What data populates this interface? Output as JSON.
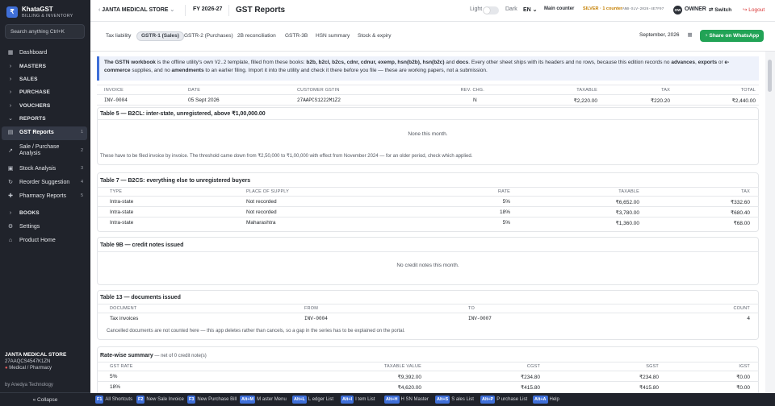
{
  "sidebar": {
    "brand_name": "KhataGST",
    "brand_sub": "BILLING & INVENTORY",
    "brand_logo": "₹",
    "search_placeholder": "Search anything  Ctrl+K",
    "items": [
      {
        "label": "Dashboard",
        "icon": "dashboard-icon",
        "glyph": "▦",
        "count": ""
      },
      {
        "label": "MASTERS",
        "icon": "chevron-right-icon",
        "glyph": "›",
        "count": ""
      },
      {
        "label": "SALES",
        "icon": "chevron-right-icon",
        "glyph": "›",
        "count": ""
      },
      {
        "label": "PURCHASE",
        "icon": "chevron-right-icon",
        "glyph": "›",
        "count": ""
      },
      {
        "label": "VOUCHERS",
        "icon": "chevron-right-icon",
        "glyph": "›",
        "count": ""
      },
      {
        "label": "REPORTS",
        "icon": "chevron-down-icon",
        "glyph": "⌄",
        "count": ""
      },
      {
        "label": "GST Reports",
        "icon": "report-icon",
        "glyph": "▤",
        "count": "1"
      },
      {
        "label": "Sale / Purchase Analysis",
        "icon": "analysis-icon",
        "glyph": "↗",
        "count": "2"
      },
      {
        "label": "Stock Analysis",
        "icon": "stock-icon",
        "glyph": "▣",
        "count": "3"
      },
      {
        "label": "Reorder Suggestion",
        "icon": "reorder-icon",
        "glyph": "↻",
        "count": "4"
      },
      {
        "label": "Pharmacy Reports",
        "icon": "pharmacy-icon",
        "glyph": "✚",
        "count": "5"
      },
      {
        "label": "BOOKS",
        "icon": "chevron-right-icon",
        "glyph": "›",
        "count": ""
      },
      {
        "label": "Settings",
        "icon": "gear-icon",
        "glyph": "⚙",
        "count": ""
      },
      {
        "label": "Product Home",
        "icon": "home-icon",
        "glyph": "⌂",
        "count": ""
      }
    ],
    "shop_name": "JANTA MEDICAL STORE",
    "shop_gstin": "27AAQCS4547K1ZN",
    "shop_type": "Medical / Pharmacy",
    "byline": "by Anedya Technology",
    "collapse_label": "« Collapse"
  },
  "topbar": {
    "store": "JANTA MEDICAL STORE",
    "fy": "FY 2026-27",
    "page_title": "GST Reports",
    "light_label": "Light",
    "dark_label": "Dark",
    "lang": "EN",
    "counter": "Main counter",
    "license": "SILVER · 1 counter",
    "license_key": "ANB-SLV-2026-4E7F97",
    "owner_initials": "OW",
    "owner": "OWNER",
    "switch_label": "Switch",
    "logout_label": "Logout"
  },
  "tabs": [
    "Tax liability",
    "GSTR-1 (Sales)",
    "GSTR-2 (Purchases)",
    "2B reconciliation",
    "GSTR-3B",
    "HSN summary",
    "Stock & expiry"
  ],
  "tab_active": "GSTR-1 (Sales)",
  "period": {
    "month": "September, 2026"
  },
  "whatsapp_label": "Share on WhatsApp",
  "banner": {
    "lead": "The GSTN workbook",
    "text1": " is the offline utility's own ",
    "version": "V2.2",
    "text2": " template, filled from these books: ",
    "books": "b2b, b2cl, b2cs, cdnr, cdnur, exemp, hsn(b2b), hsn(b2c)",
    "text3": " and ",
    "books_last": "docs",
    "text4": ". Every other sheet ships with its headers and no rows, because this edition records no ",
    "adv": "advances",
    "text5": ", ",
    "exp": "exports",
    "text6": " or ",
    "ecom": "e-commerce",
    "text7": " supplies, and no ",
    "amend": "amendments",
    "text8": " to an earlier filing. Import it into the utility and check it there before you file — these are working papers, not a submission."
  },
  "b2b": {
    "headers": [
      "INVOICE",
      "DATE",
      "CUSTOMER GSTIN",
      "REV. CHG.",
      "TAXABLE",
      "TAX",
      "TOTAL"
    ],
    "rows": [
      [
        "INV-0004",
        "05 Sept 2026",
        "27AAPCS1222M1Z2",
        "N",
        "₹2,220.00",
        "₹220.20",
        "₹2,440.00"
      ]
    ]
  },
  "b2cl": {
    "title": "Table 5 — B2CL: inter-state, unregistered, above ₹1,00,000.00",
    "empty": "None this month.",
    "note": "These have to be filed invoice by invoice. The threshold came down from ₹2,50,000 to ₹1,00,000 with effect from November 2024 — for an older period, check which applied."
  },
  "b2cs": {
    "title": "Table 7 — B2CS: everything else to unregistered buyers",
    "headers": [
      "TYPE",
      "PLACE OF SUPPLY",
      "RATE",
      "TAXABLE",
      "TAX"
    ],
    "rows": [
      [
        "Intra-state",
        "Not recorded",
        "5%",
        "₹6,652.00",
        "₹332.60"
      ],
      [
        "Intra-state",
        "Not recorded",
        "18%",
        "₹3,780.00",
        "₹680.40"
      ],
      [
        "Intra-state",
        "Maharashtra",
        "5%",
        "₹1,360.00",
        "₹68.00"
      ]
    ]
  },
  "cdn": {
    "title": "Table 9B — credit notes issued",
    "empty": "No credit notes this month."
  },
  "docs": {
    "title": "Table 13 — documents issued",
    "headers": [
      "DOCUMENT",
      "FROM",
      "TO",
      "COUNT"
    ],
    "rows": [
      [
        "Tax invoices",
        "INV-0004",
        "INV-0007",
        "4"
      ]
    ],
    "note": "Cancelled documents are not counted here — this app deletes rather than cancels, so a gap in the series has to be explained on the portal."
  },
  "ratewise": {
    "title": "Rate-wise summary",
    "subtitle": " — net of 0 credit note(s)",
    "headers": [
      "GST RATE",
      "TAXABLE VALUE",
      "CGST",
      "SGST",
      "IGST"
    ],
    "rows": [
      [
        "5%",
        "₹9,392.00",
        "₹234.80",
        "₹234.80",
        "₹0.00"
      ],
      [
        "18%",
        "₹4,620.00",
        "₹415.80",
        "₹415.80",
        "₹0.00"
      ]
    ]
  },
  "shortcuts": [
    {
      "key": "F1",
      "label": "All Shortcuts"
    },
    {
      "key": "F2",
      "label": "New Sale Invoice"
    },
    {
      "key": "F3",
      "label": "New Purchase Bill"
    },
    {
      "key": "Alt+M",
      "label": "M aster Menu"
    },
    {
      "key": "Alt+L",
      "label": "L edger List"
    },
    {
      "key": "Alt+I",
      "label": "I tem List"
    },
    {
      "key": "Alt+H",
      "label": "H SN Master"
    },
    {
      "key": "Alt+S",
      "label": "S ales List"
    },
    {
      "key": "Alt+P",
      "label": "P urchase List"
    },
    {
      "key": "Alt+A",
      "label": "Help"
    }
  ],
  "colors": {
    "accent": "#3f6fd8",
    "sidebar": "#20232b",
    "whatsapp": "#22a356",
    "logout": "#d93636"
  }
}
